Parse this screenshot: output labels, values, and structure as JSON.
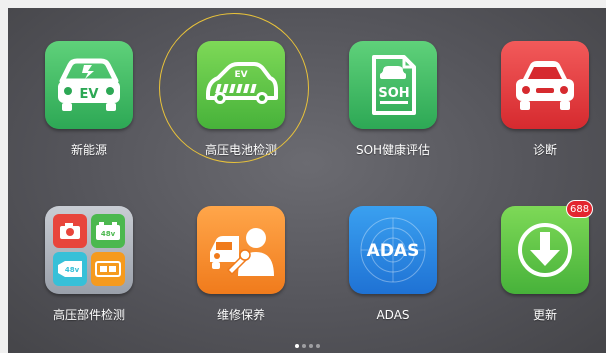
{
  "apps": [
    {
      "label": "新能源",
      "icon": "ev-car-icon"
    },
    {
      "label": "高压电池检测",
      "icon": "ev-battery-icon",
      "selected": true
    },
    {
      "label": "SOH健康评估",
      "icon": "soh-document-icon"
    },
    {
      "label": "诊断",
      "icon": "car-diagnosis-icon"
    },
    {
      "label": "高压部件检测",
      "icon": "hv-components-icon"
    },
    {
      "label": "维修保养",
      "icon": "maintenance-icon"
    },
    {
      "label": "ADAS",
      "icon": "adas-radar-icon"
    },
    {
      "label": "更新",
      "icon": "download-icon",
      "badge": "688"
    }
  ],
  "icon_text": {
    "ev_car": "EV",
    "ev_battery": "EV",
    "soh": "SOH",
    "voltage": "48v",
    "adas": "ADAS"
  },
  "pager": {
    "pages": 4,
    "current": 1
  },
  "colors": {
    "background": "#55555b",
    "selection_ring": "#e8c23a",
    "badge": "#e3262f"
  }
}
